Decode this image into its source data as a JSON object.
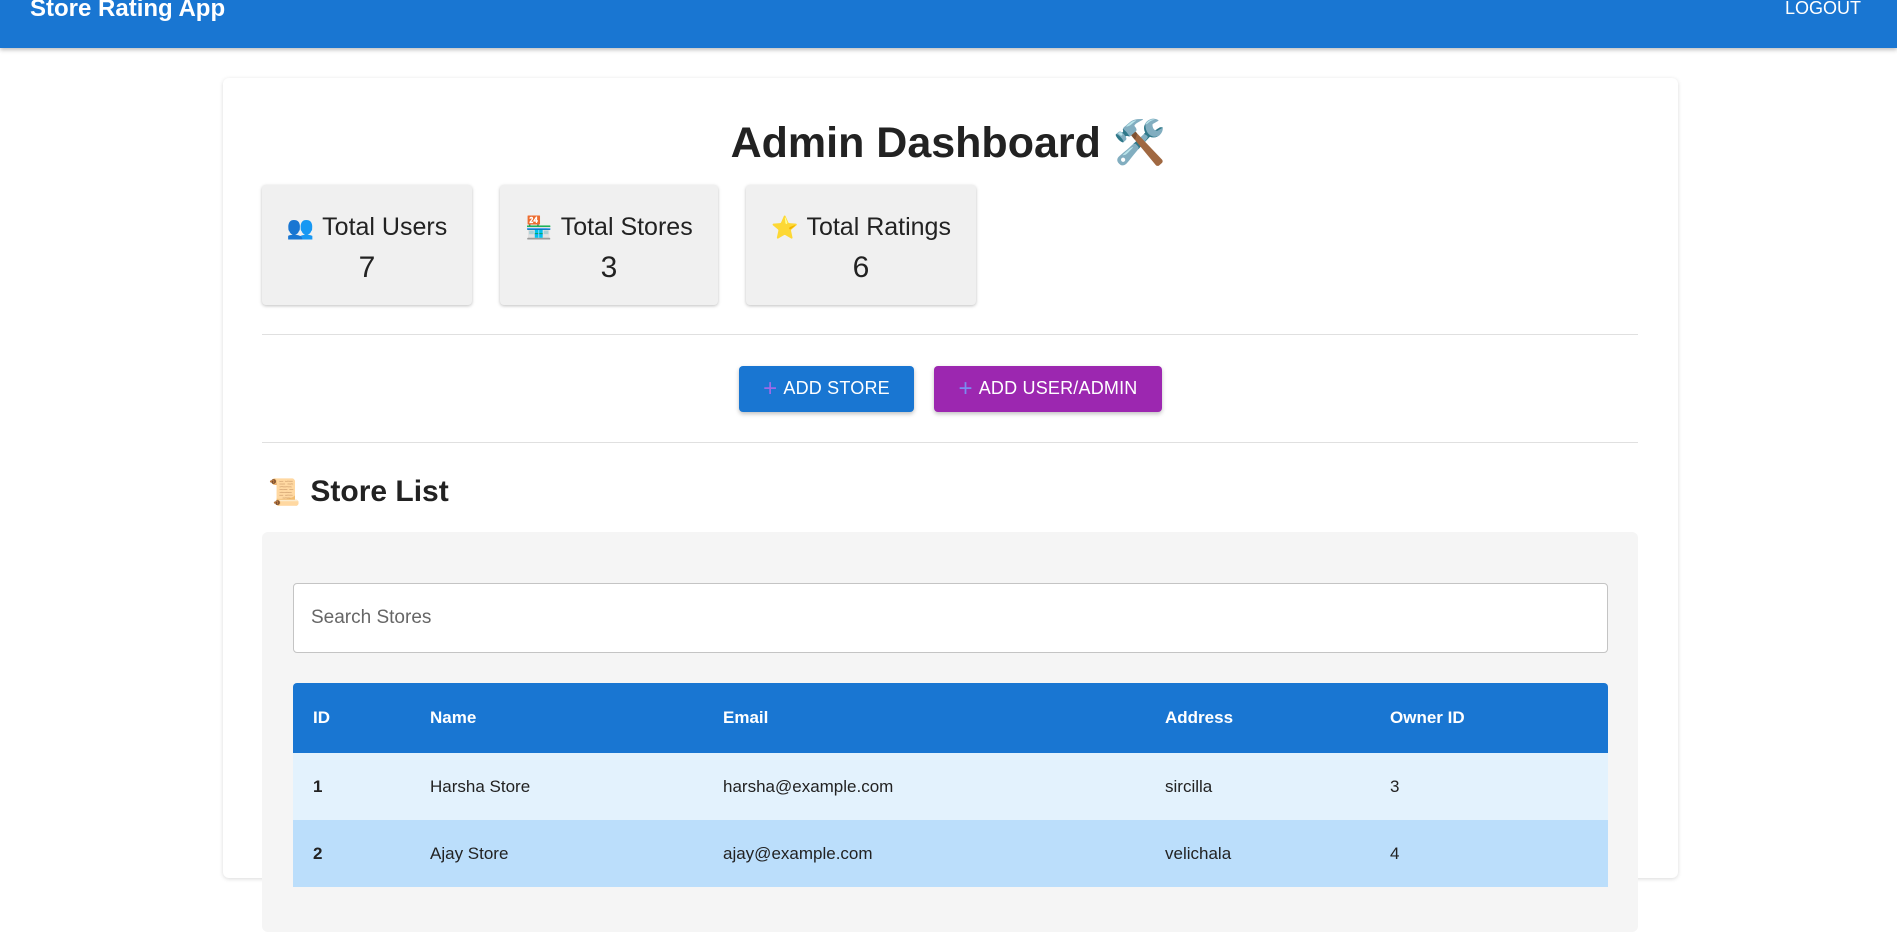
{
  "app": {
    "title": "Store Rating App",
    "logout_label": "LOGOUT"
  },
  "dashboard": {
    "title": "Admin Dashboard",
    "title_emoji": "🛠️"
  },
  "stats": [
    {
      "icon": "👥",
      "label": "Total Users",
      "value": "7"
    },
    {
      "icon": "🏪",
      "label": "Total Stores",
      "value": "3"
    },
    {
      "icon": "⭐",
      "label": "Total Ratings",
      "value": "6"
    }
  ],
  "actions": {
    "add_store": "ADD STORE",
    "add_user": "ADD USER/ADMIN",
    "plus_icon": "+"
  },
  "store_list": {
    "icon": "📜",
    "title": "Store List",
    "search_placeholder": "Search Stores",
    "columns": [
      "ID",
      "Name",
      "Email",
      "Address",
      "Owner ID"
    ],
    "rows": [
      [
        "1",
        "Harsha Store",
        "harsha@example.com",
        "sircilla",
        "3"
      ],
      [
        "2",
        "Ajay Store",
        "ajay@example.com",
        "velichala",
        "4"
      ]
    ]
  },
  "colors": {
    "primary": "#1976d2",
    "secondary": "#9c27b0",
    "row_light": "#e3f2fd",
    "row_dark": "#bbdefb"
  }
}
